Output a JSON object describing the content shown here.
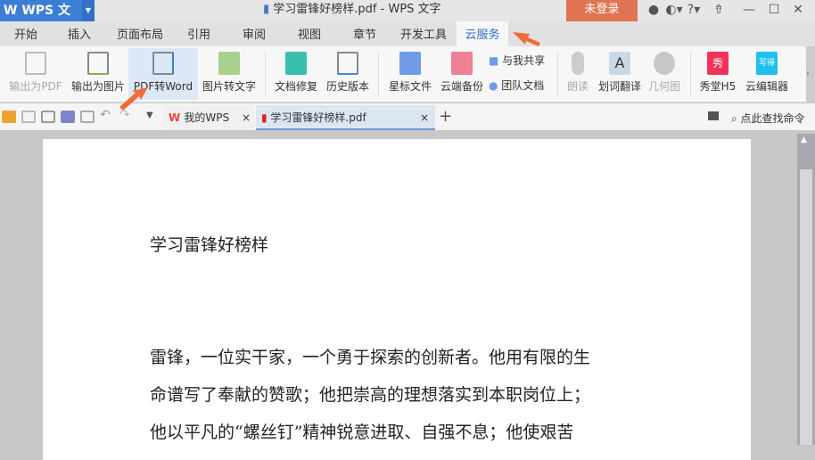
{
  "titlebar": {
    "app": "WPS 文字",
    "doc_title": "学习雷锋好榜样.pdf - WPS 文字",
    "login": "未登录",
    "help": "?"
  },
  "tabs": [
    "开始",
    "插入",
    "页面布局",
    "引用",
    "审阅",
    "视图",
    "章节",
    "开发工具",
    "云服务"
  ],
  "ribbon": {
    "export_pdf": "输出为PDF",
    "export_image": "输出为图片",
    "pdf_to_word": "PDF转Word",
    "image_to_text": "图片转文字",
    "doc_repair": "文档修复",
    "history": "历史版本",
    "starred": "星标文件",
    "cloud_backup": "云端备份",
    "shared": "与我共享",
    "team_docs": "团队文档",
    "read_aloud": "朗读",
    "translate": "划词翻译",
    "geometry": "几何图",
    "xiutang": "秀堂H5",
    "cloud_editor": "云编辑器"
  },
  "doc_tabs": {
    "my_wps": "我的WPS",
    "current": "学习雷锋好榜样.pdf",
    "close": "×",
    "add": "+"
  },
  "search_cmd": "点此查找命令",
  "document": {
    "title": "学习雷锋好榜样",
    "lines": [
      "雷锋，一位实干家，一个勇于探索的创新者。他用有限的生",
      "命谱写了奉献的赞歌；他把崇高的理想落实到本职岗位上；",
      "他以平凡的“螺丝钉”精神锐意进取、自强不息；他使艰苦"
    ]
  },
  "colors": {
    "accent": "#2f6fc9",
    "login": "#e07452",
    "arrow": "#f26b3a"
  }
}
